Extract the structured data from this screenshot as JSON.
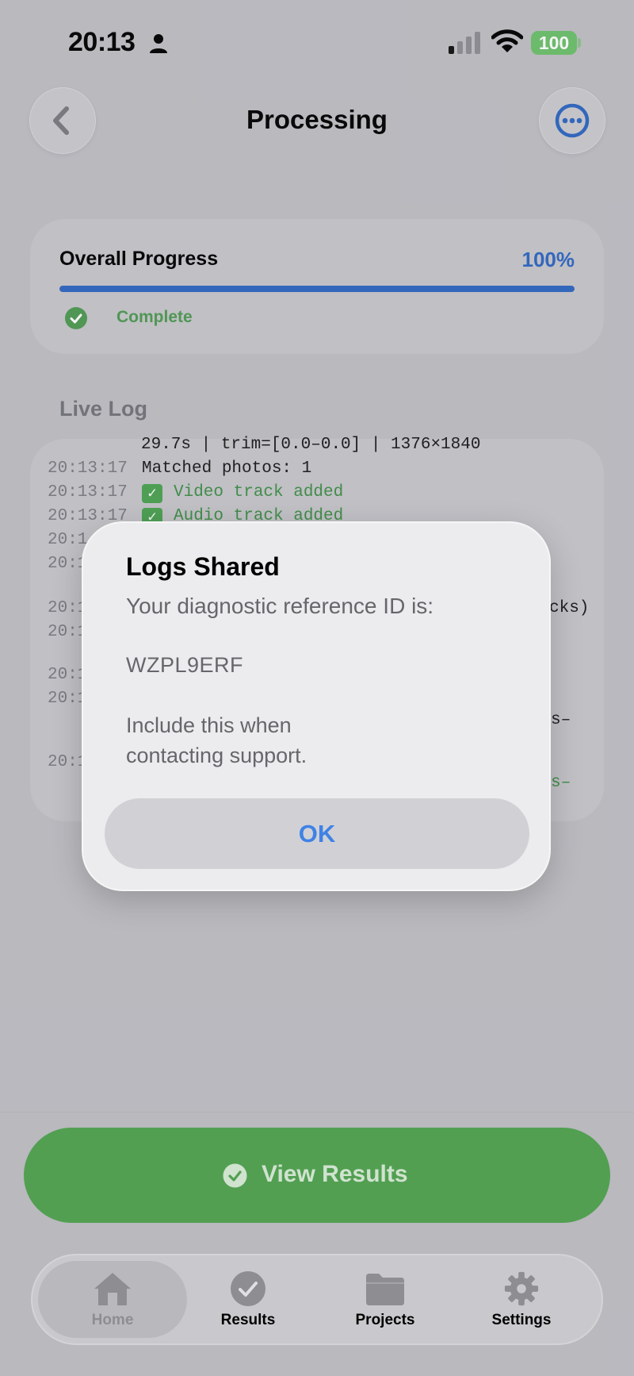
{
  "status_bar": {
    "time": "20:13",
    "battery": "100"
  },
  "nav": {
    "title": "Processing"
  },
  "progress": {
    "label": "Overall Progress",
    "percent_text": "100%",
    "percent_value": 100,
    "status": "Complete",
    "accent_color": "#2e67c2",
    "status_color": "#4e9a51"
  },
  "live_log": {
    "title": "Live Log",
    "partial_top_line": "29.7s | trim=[0.0–0.0] | 1376×1840",
    "entries": [
      {
        "time": "20:13:17",
        "message": "Matched photos: 1"
      },
      {
        "time": "20:13:17",
        "message": "Video track added"
      },
      {
        "time": "20:13:17",
        "message": "Audio track added"
      }
    ],
    "obscured_fragment_1": "cks)",
    "obscured_fragment_2": "s–",
    "obscured_fragment_3": "s–"
  },
  "alert": {
    "title": "Logs Shared",
    "message": "Your diagnostic reference ID is:",
    "reference_id": "WZPL9ERF",
    "note": "Include this when contacting support.",
    "ok_label": "OK"
  },
  "primary_action": {
    "label": "View Results",
    "color": "#529f52"
  },
  "tabbar": {
    "tabs": [
      {
        "label": "Home",
        "icon": "house-icon",
        "selected": true
      },
      {
        "label": "Results",
        "icon": "checkmark-circle-icon",
        "selected": false
      },
      {
        "label": "Projects",
        "icon": "folder-icon",
        "selected": false
      },
      {
        "label": "Settings",
        "icon": "gear-icon",
        "selected": false
      }
    ]
  }
}
